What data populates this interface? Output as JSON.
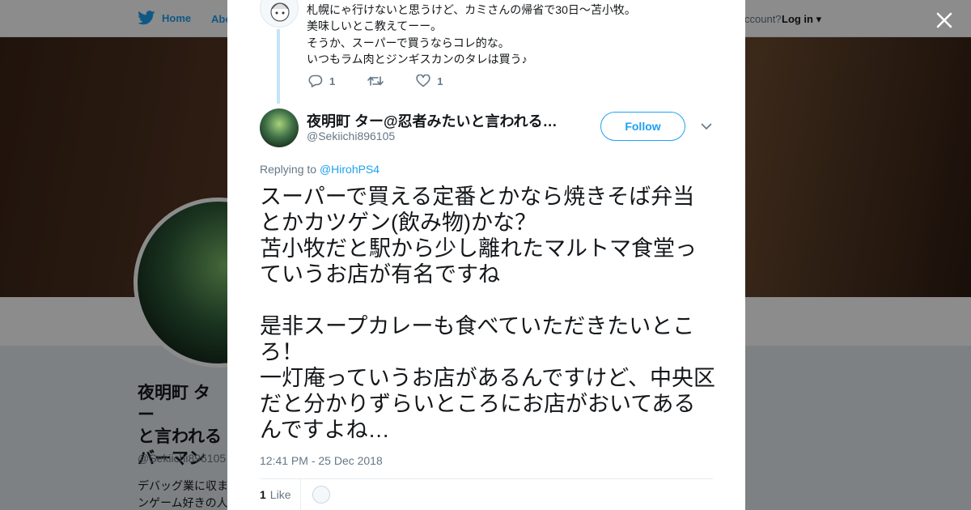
{
  "topbar": {
    "home_label": "Home",
    "about_label": "Abo",
    "account_prompt": "ccount?",
    "login_label": "Log in"
  },
  "profile": {
    "name": "夜明町 ター\nと言われる\nバーマン",
    "handle": "@Sekiichi896105",
    "bio": "デバッグ業に収ま\nンゲーム好きの人"
  },
  "prev_tweet": {
    "lines": [
      "札幌にゃ行けないと思うけど、カミさんの帰省で30日～苫小牧。",
      "美味しいとこ教えてーー。",
      "そうか、スーパーで買うならコレ的な。",
      "いつもラム肉とジンギスカンのタレは買う♪"
    ],
    "reply_count": "1",
    "like_count": "1"
  },
  "tweet": {
    "author_name": "夜明町 ター@忍者みたいと言われる…",
    "author_handle": "@Sekiichi896105",
    "follow_label": "Follow",
    "replying_prefix": "Replying to",
    "replying_to": "@HirohPS4",
    "text": "スーパーで買える定番とかなら焼きそば弁当とかカツゲン(飲み物)かな？\n苫小牧だと駅から少し離れたマルトマ食堂っていうお店が有名ですね\n\n是非スープカレーも食べていただきたいところ！\n一灯庵っていうお店があるんですけど、中央区だと分かりずらいところにお店がおいてあるんですよね…",
    "timestamp": "12:41 PM - 25 Dec 2018",
    "like_count": "1",
    "like_label": "Like"
  },
  "colors": {
    "brand": "#1da1f2",
    "text": "#14171a",
    "muted": "#657786",
    "thread_line": "#c4e4f7"
  },
  "icons": {
    "logo": "twitter-bird-icon",
    "close": "close-icon",
    "reply": "reply-icon",
    "retweet": "retweet-icon",
    "like": "heart-icon",
    "menu": "chevron-down-icon"
  }
}
